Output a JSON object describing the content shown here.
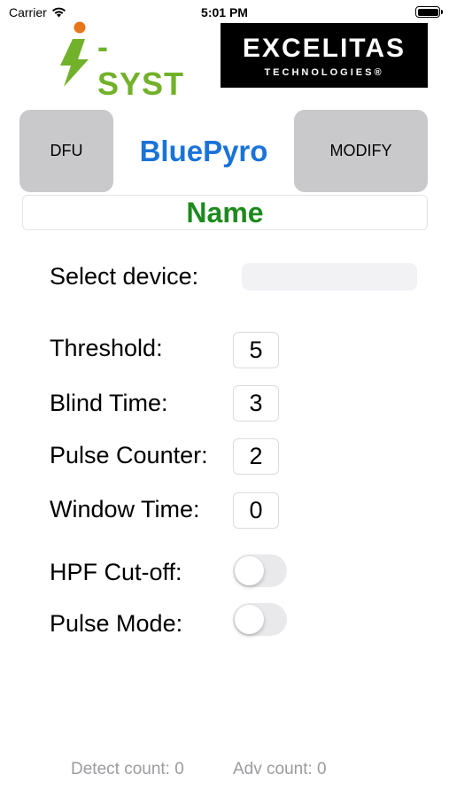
{
  "status_bar": {
    "carrier": "Carrier",
    "time": "5:01 PM"
  },
  "logos": {
    "isyst": {
      "text": "-SYST",
      "name": "I-SYST",
      "color": "#72b12a"
    },
    "excelitas": {
      "main": "EXCELITAS",
      "sub": "TECHNOLOGIES®"
    }
  },
  "buttons": {
    "dfu": "DFU",
    "modify": "MODIFY"
  },
  "app_title": "BluePyro",
  "name_field": "Name",
  "select_device": {
    "label": "Select device:",
    "value": ""
  },
  "settings": [
    {
      "label": "Threshold:",
      "value": "5"
    },
    {
      "label": "Blind Time:",
      "value": "3"
    },
    {
      "label": "Pulse Counter:",
      "value": "2"
    },
    {
      "label": "Window Time:",
      "value": "0"
    }
  ],
  "toggles": [
    {
      "label": "HPF Cut-off:",
      "on": false
    },
    {
      "label": "Pulse Mode:",
      "on": false
    }
  ],
  "footer": {
    "detect_count": "Detect count: 0",
    "adv_count": "Adv count: 0"
  },
  "colors": {
    "title_blue": "#1a73d9",
    "name_green": "#1e8a1e",
    "button_gray": "#c9c9cb"
  },
  "icons": [
    "wifi-icon",
    "battery-icon",
    "isyst-logo",
    "excelitas-logo"
  ]
}
